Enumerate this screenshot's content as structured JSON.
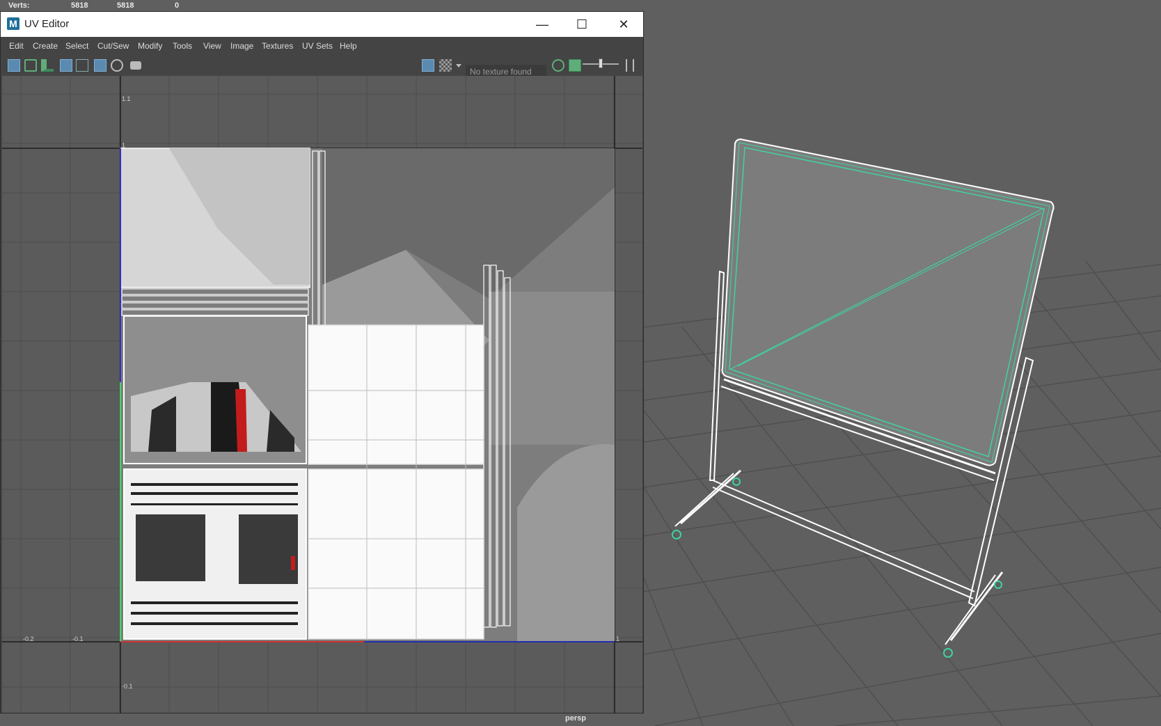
{
  "hud": {
    "verts_label": "Verts:",
    "verts_values": [
      "5818",
      "5818",
      "0"
    ]
  },
  "window": {
    "app_icon": "M",
    "title": "UV Editor",
    "controls": {
      "minimize": "—",
      "maximize": "☐",
      "close": "✕"
    }
  },
  "menu": [
    "Edit",
    "Create",
    "Select",
    "Cut/Sew",
    "Modify",
    "Tools",
    "View",
    "Image",
    "Textures",
    "UV Sets",
    "Help"
  ],
  "toolbar": {
    "texture_field": "No texture found",
    "icons": [
      "uv-shell-icon",
      "uv-select-icon",
      "uv-stack-icon",
      "frame-icon",
      "tile-icon",
      "grid-icon",
      "snap-icon",
      "snapshot-icon",
      "image-display-icon",
      "checker-icon",
      "dropdown-arrow-icon",
      "refresh-icon",
      "image-icon",
      "slider-icon",
      "step-icon"
    ]
  },
  "uv_axes": {
    "labels": [
      "1.1",
      "1",
      "-0.2",
      "-0.1",
      "-0.1"
    ],
    "u_right_label": "1"
  },
  "viewport": {
    "camera": "persp"
  },
  "colors": {
    "accent": "#3fd3a0",
    "wire": "#ffffff",
    "window_bg": "#444444",
    "titlebar": "#ffffff"
  }
}
